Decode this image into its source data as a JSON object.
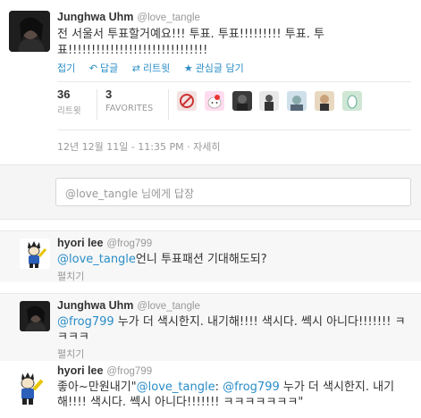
{
  "main_tweet": {
    "author_name": "Junghwa Uhm",
    "author_handle": "@love_tangle",
    "text": "전 서울서 투표할거예요!!! 투표. 투표!!!!!!!!! 투표. 투표!!!!!!!!!!!!!!!!!!!!!!!!!!!!!!",
    "actions": {
      "collapse": "접기",
      "reply": "답글",
      "retweet": "리트윗",
      "favorite": "관심글 담기"
    },
    "stats": {
      "retweets_count": "36",
      "retweets_label": "리트윗",
      "favorites_count": "3",
      "favorites_label": "FAVORITES"
    },
    "timestamp": "12년 12월 11일 - 11:35 PM",
    "details_link": "자세히"
  },
  "reply_box": {
    "placeholder": "@love_tangle  님에게 답장"
  },
  "replies": [
    {
      "author_name": "hyori lee",
      "author_handle": "@frog799",
      "mention": "@love_tangle",
      "text": "언니 투표패션 기대해도되?",
      "expand": "펼치기"
    },
    {
      "author_name": "Junghwa Uhm",
      "author_handle": "@love_tangle",
      "mention": "@frog799",
      "text": " 누가 더 색시한지. 내기해!!!! 색시다. 쎅시 아니다!!!!!!! ㅋㅋㅋㅋ",
      "expand": "펼치기"
    },
    {
      "author_name": "hyori lee",
      "author_handle": "@frog799",
      "text_prefix": "좋아~만원내기\"",
      "mention1": "@love_tangle",
      "text_mid": ": ",
      "mention2": "@frog799",
      "text_suffix": " 누가 더 색시한지. 내기해!!!! 색시다. 쎅시 아니다!!!!!!! ㅋㅋㅋㅋㅋㅋㅋ\""
    }
  ],
  "colors": {
    "link": "#2a8dc7",
    "muted": "#999999",
    "text": "#333333"
  }
}
